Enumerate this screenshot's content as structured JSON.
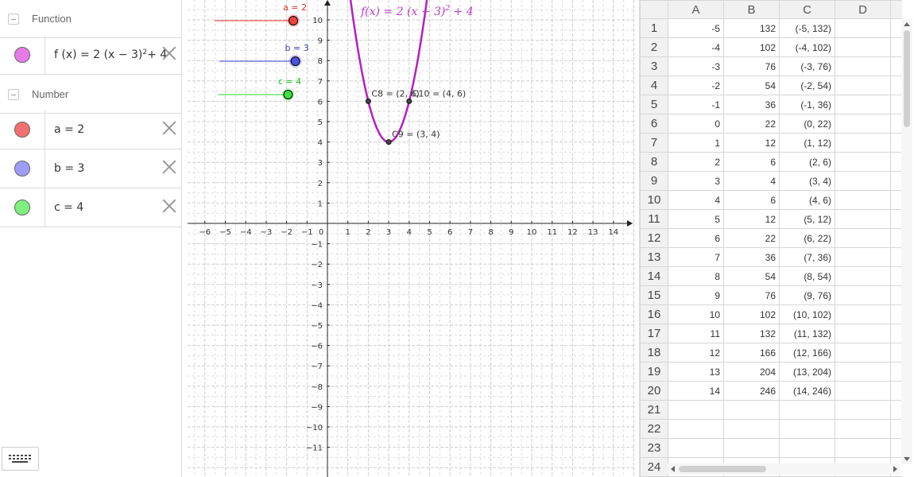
{
  "algebra": {
    "groups": [
      {
        "label": "Function"
      },
      {
        "label": "Number"
      }
    ],
    "function_row": {
      "expr": "f (x)  =  2  (x − 3)",
      "exp": "2",
      "tail": " + 4",
      "color": "#e77ae6"
    },
    "number_rows": [
      {
        "expr": "a  =  2",
        "color": "#f27070"
      },
      {
        "expr": "b  =  3",
        "color": "#9d9df5"
      },
      {
        "expr": "c  =  4",
        "color": "#7ef07e"
      }
    ]
  },
  "graphics": {
    "x_ticks": [
      "−6",
      "−5",
      "−4",
      "−3",
      "−2",
      "−1",
      "0",
      "1",
      "2",
      "3",
      "4",
      "5",
      "6",
      "7",
      "8",
      "9",
      "10",
      "11",
      "12",
      "13",
      "14"
    ],
    "y_ticks_pos": [
      "1",
      "2",
      "3",
      "4",
      "5",
      "6",
      "7",
      "8",
      "9",
      "10"
    ],
    "y_ticks_neg": [
      "−1",
      "−2",
      "−3",
      "−4",
      "−5",
      "−6",
      "−7",
      "−8",
      "−9",
      "−10",
      "−11"
    ],
    "function_label": {
      "main": "f(x)  =  2  (x − 3)",
      "exp": "2",
      "tail": " + 4"
    },
    "function_params": {
      "a": 2,
      "b": 3,
      "c": 4
    },
    "points": [
      {
        "label": "C8 = (2, 6)",
        "x": 2,
        "y": 6
      },
      {
        "label": "C10 = (4, 6)",
        "x": 4,
        "y": 6
      },
      {
        "label": "C9 = (3, 4)",
        "x": 3,
        "y": 4
      }
    ],
    "sliders": [
      {
        "label": "a = 2",
        "value": 2,
        "color": "#e03030",
        "fill": "#f04040"
      },
      {
        "label": "b = 3",
        "value": 3,
        "color": "#4040c8",
        "fill": "#5050e0"
      },
      {
        "label": "c = 4",
        "value": 4,
        "color": "#20c020",
        "fill": "#40e040"
      }
    ],
    "colors": {
      "function": "#b41fc4",
      "grid": "#c8c8c8",
      "axis": "#222"
    }
  },
  "sheet": {
    "columns": [
      "A",
      "B",
      "C",
      "D"
    ],
    "rows": [
      {
        "n": "1",
        "a": "-5",
        "b": "132",
        "c": "(-5, 132)"
      },
      {
        "n": "2",
        "a": "-4",
        "b": "102",
        "c": "(-4, 102)"
      },
      {
        "n": "3",
        "a": "-3",
        "b": "76",
        "c": "(-3, 76)"
      },
      {
        "n": "4",
        "a": "-2",
        "b": "54",
        "c": "(-2, 54)"
      },
      {
        "n": "5",
        "a": "-1",
        "b": "36",
        "c": "(-1, 36)"
      },
      {
        "n": "6",
        "a": "0",
        "b": "22",
        "c": "(0, 22)"
      },
      {
        "n": "7",
        "a": "1",
        "b": "12",
        "c": "(1, 12)"
      },
      {
        "n": "8",
        "a": "2",
        "b": "6",
        "c": "(2, 6)"
      },
      {
        "n": "9",
        "a": "3",
        "b": "4",
        "c": "(3, 4)"
      },
      {
        "n": "10",
        "a": "4",
        "b": "6",
        "c": "(4, 6)"
      },
      {
        "n": "11",
        "a": "5",
        "b": "12",
        "c": "(5, 12)"
      },
      {
        "n": "12",
        "a": "6",
        "b": "22",
        "c": "(6, 22)"
      },
      {
        "n": "13",
        "a": "7",
        "b": "36",
        "c": "(7, 36)"
      },
      {
        "n": "14",
        "a": "8",
        "b": "54",
        "c": "(8, 54)"
      },
      {
        "n": "15",
        "a": "9",
        "b": "76",
        "c": "(9, 76)"
      },
      {
        "n": "16",
        "a": "10",
        "b": "102",
        "c": "(10, 102)"
      },
      {
        "n": "17",
        "a": "11",
        "b": "132",
        "c": "(11, 132)"
      },
      {
        "n": "18",
        "a": "12",
        "b": "166",
        "c": "(12, 166)"
      },
      {
        "n": "19",
        "a": "13",
        "b": "204",
        "c": "(13, 204)"
      },
      {
        "n": "20",
        "a": "14",
        "b": "246",
        "c": "(14, 246)"
      },
      {
        "n": "21",
        "a": "",
        "b": "",
        "c": ""
      },
      {
        "n": "22",
        "a": "",
        "b": "",
        "c": ""
      },
      {
        "n": "23",
        "a": "",
        "b": "",
        "c": ""
      },
      {
        "n": "24",
        "a": "",
        "b": "",
        "c": ""
      }
    ]
  }
}
